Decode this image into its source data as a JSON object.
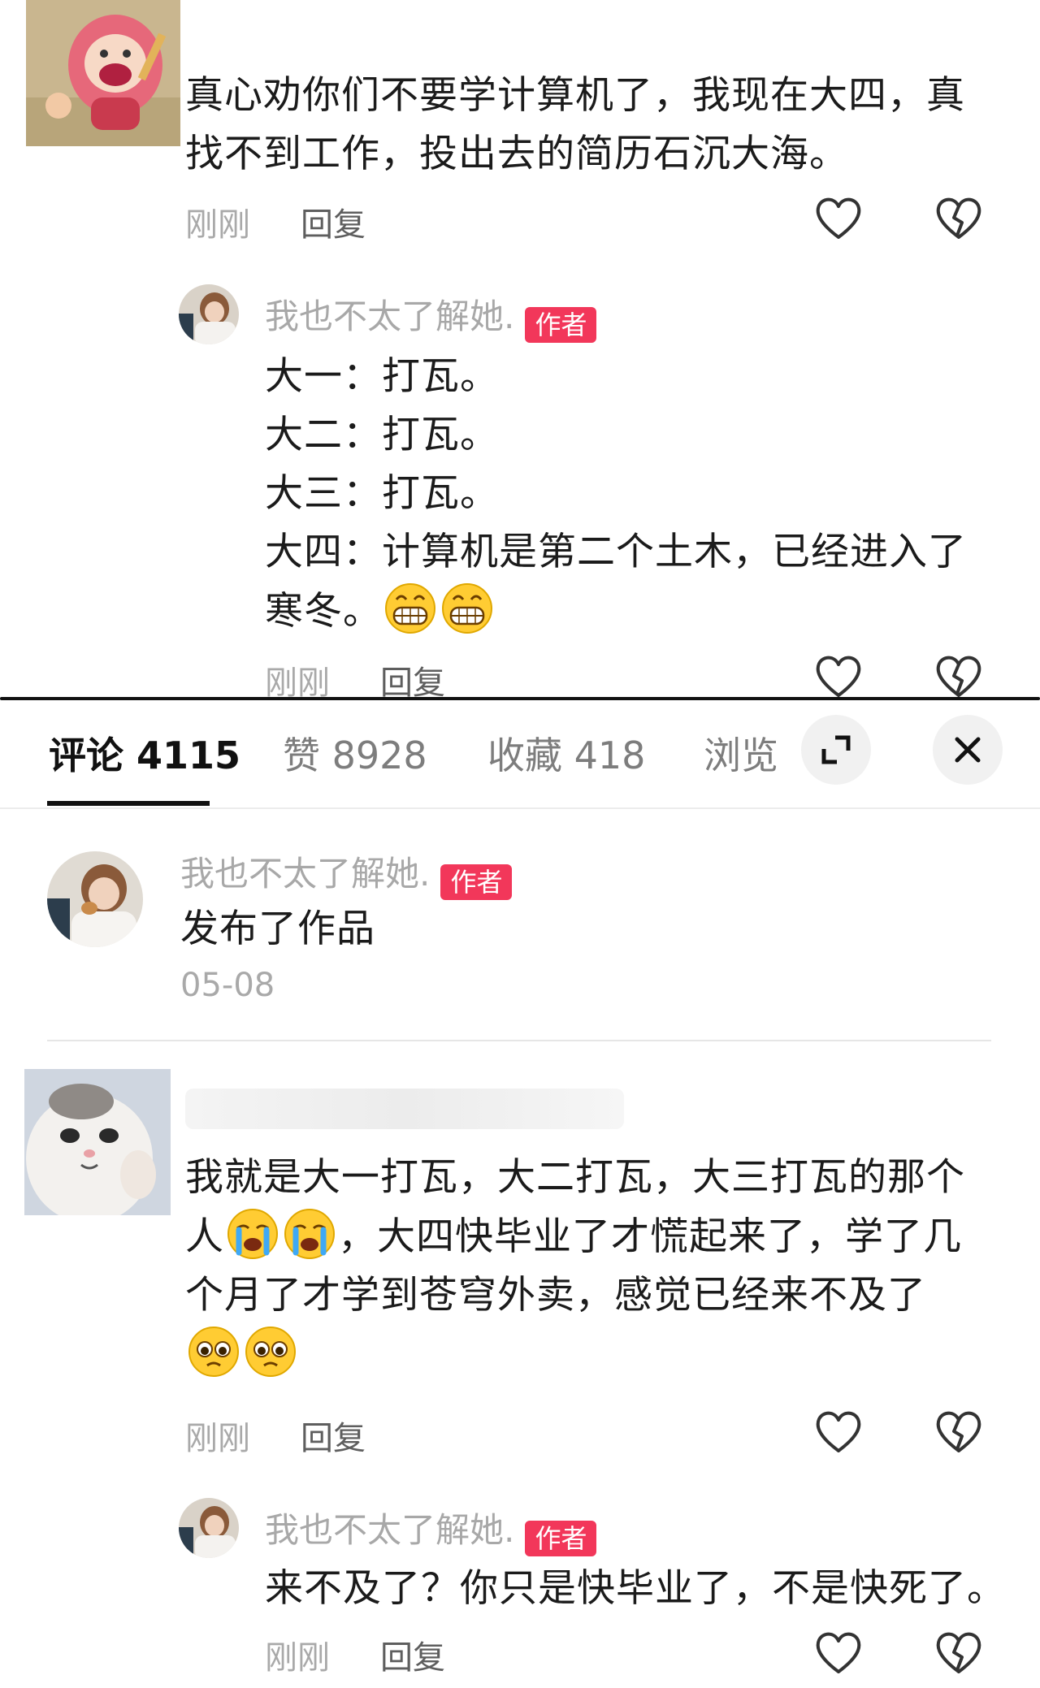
{
  "comment1": {
    "text": "真心劝你们不要学计算机了，我现在大四，真找不到工作，投出去的简历石沉大海。",
    "time": "刚刚",
    "reply_label": "回复"
  },
  "reply1": {
    "author": "我也不太了解她.",
    "badge": "作者",
    "lines": [
      "大一：打瓦。",
      "大二：打瓦。",
      "大三：打瓦。",
      "大四：计算机是第二个土木，已经进入了",
      "寒冬。"
    ],
    "time": "刚刚",
    "reply_label": "回复"
  },
  "tabs": {
    "comments": "评论 4115",
    "likes": "赞 8928",
    "favorites": "收藏 418",
    "views": "浏览"
  },
  "post": {
    "author": "我也不太了解她.",
    "badge": "作者",
    "text": "发布了作品",
    "date": "05-08"
  },
  "comment2": {
    "line1": "我就是大一打瓦，大二打瓦，大三打瓦的那个",
    "line2a": "人",
    "line2b": "，大四快毕业了才慌起来了，学了几",
    "line3": "个月了才学到苍穹外卖，感觉已经来不及了",
    "time": "刚刚",
    "reply_label": "回复"
  },
  "reply2": {
    "author": "我也不太了解她.",
    "badge": "作者",
    "text": "来不及了？你只是快毕业了，不是快死了。",
    "time": "刚刚",
    "reply_label": "回复"
  },
  "icons": {
    "like": "heart-outline-icon",
    "dislike": "broken-heart-icon",
    "expand": "expand-icon",
    "close": "close-icon",
    "grin": "grinning-emoji",
    "crying": "crying-emoji",
    "pleading": "pleading-emoji"
  },
  "colors": {
    "badge": "#f2375a",
    "text": "#1b1b1b",
    "meta": "#a9a9a9",
    "tab_underline": "#111111"
  }
}
